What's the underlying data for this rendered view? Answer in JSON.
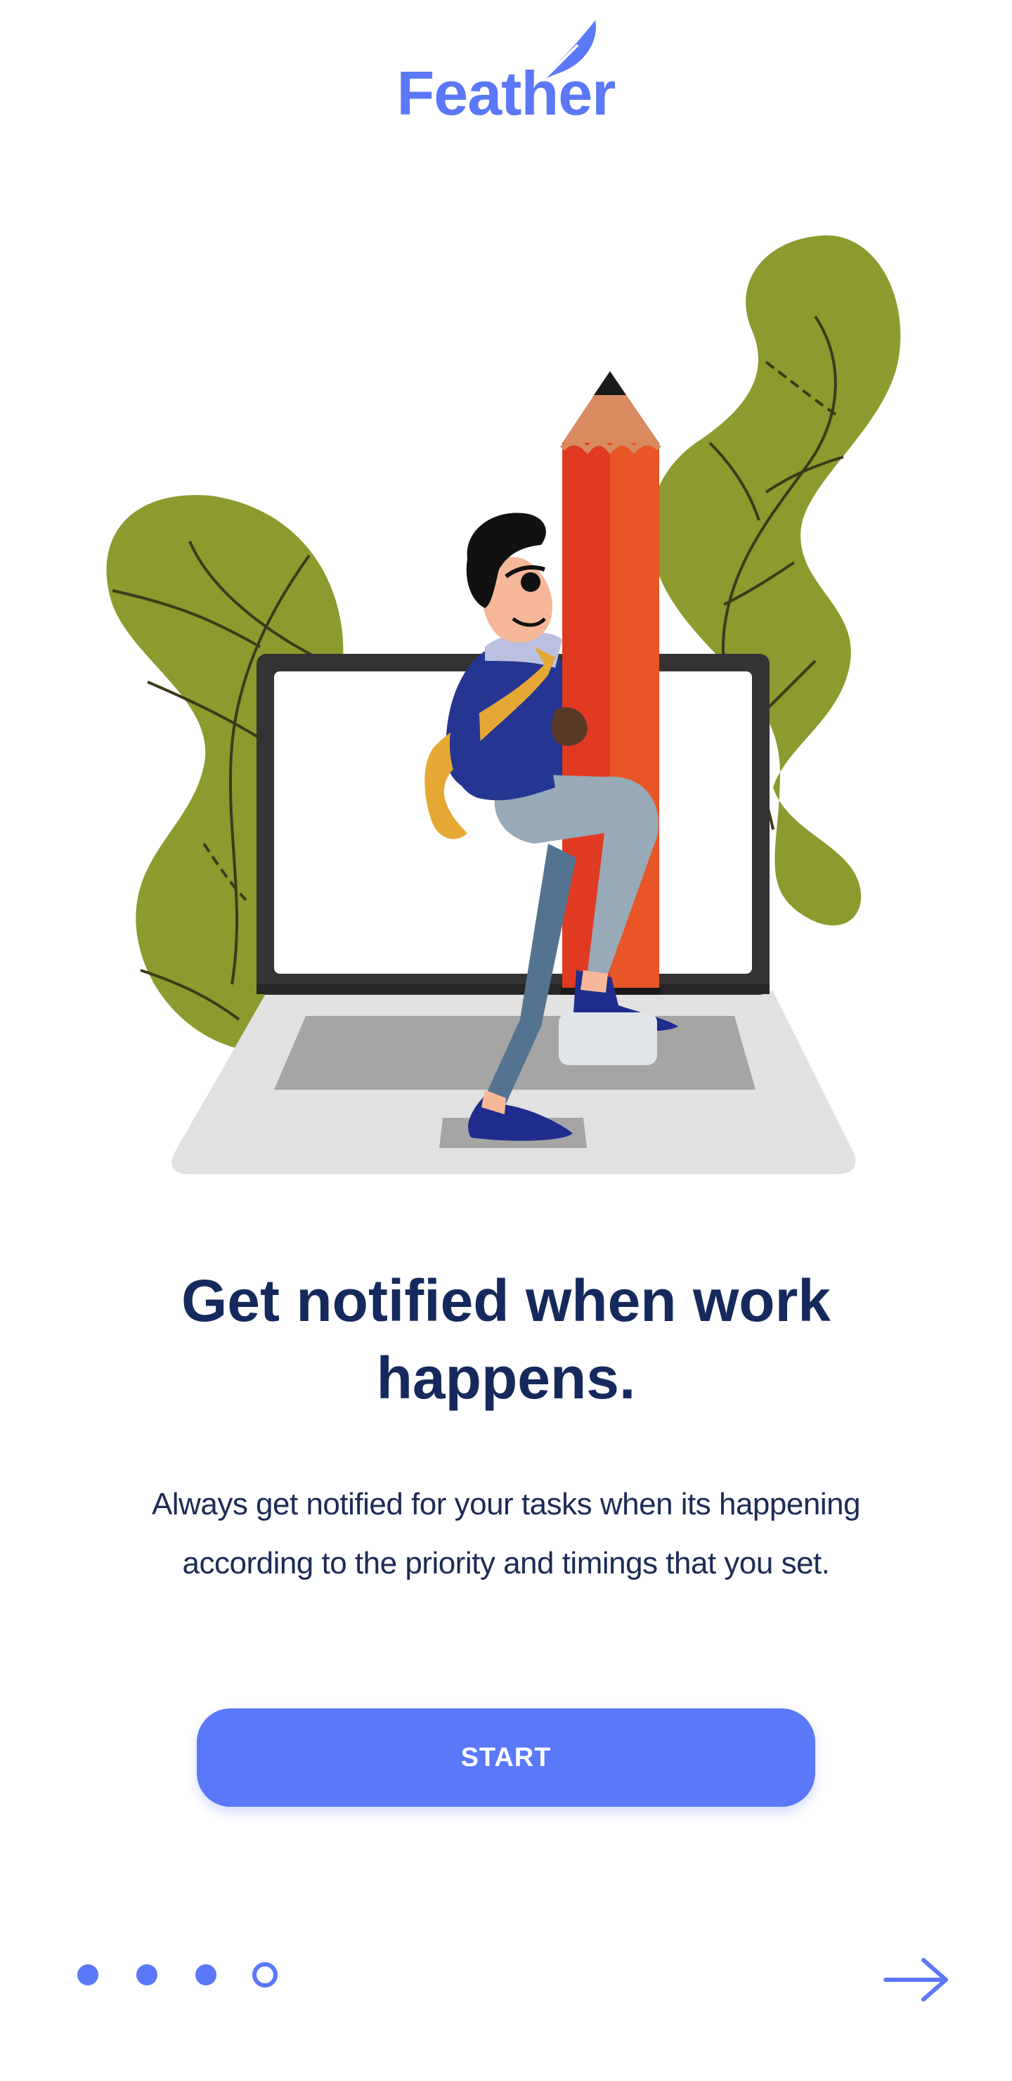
{
  "brand": {
    "name": "Feather",
    "color": "#5a78f8"
  },
  "illustration": {
    "icon": "man-with-pencil-on-laptop-illustration"
  },
  "onboarding": {
    "headline_line1": "Get notified when work",
    "headline_line2": "happens.",
    "description_line1": "Always get notified for your tasks when its happening",
    "description_line2": "according to the priority and timings that you set.",
    "start_label": "START"
  },
  "pagination": {
    "total": 4,
    "current": 4
  },
  "navigation": {
    "next_icon": "arrow-right-icon"
  },
  "colors": {
    "primary": "#5a78f8",
    "heading": "#152a5c",
    "text": "#1d2b55",
    "leaf": "#8c9a2e"
  }
}
